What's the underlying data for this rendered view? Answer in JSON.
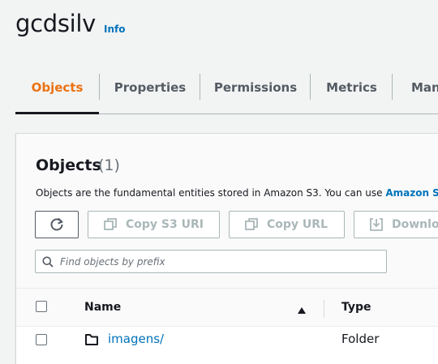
{
  "header": {
    "bucket_name": "gcdsilv",
    "info_label": "Info"
  },
  "tabs": [
    {
      "label": "Objects",
      "active": true
    },
    {
      "label": "Properties",
      "active": false
    },
    {
      "label": "Permissions",
      "active": false
    },
    {
      "label": "Metrics",
      "active": false
    },
    {
      "label": "Man",
      "active": false
    }
  ],
  "objects_panel": {
    "heading": "Objects",
    "count": "(1)",
    "description": "Objects are the fundamental entities stored in Amazon S3. You can use ",
    "description_link": "Amazon S",
    "buttons": {
      "copy_s3_uri": "Copy S3 URI",
      "copy_url": "Copy URL",
      "download": "Downlo"
    },
    "search": {
      "placeholder": "Find objects by prefix",
      "value": ""
    }
  },
  "table": {
    "columns": [
      "Name",
      "Type"
    ],
    "sort": {
      "column": "Name",
      "direction": "ascending"
    },
    "rows": [
      {
        "name": "imagens/",
        "type": "Folder",
        "icon": "folder-icon",
        "selected": false
      }
    ]
  },
  "colors": {
    "accent": "#ec7211",
    "link": "#0073bb",
    "text": "#16191f",
    "disabled": "#aab7b8"
  }
}
